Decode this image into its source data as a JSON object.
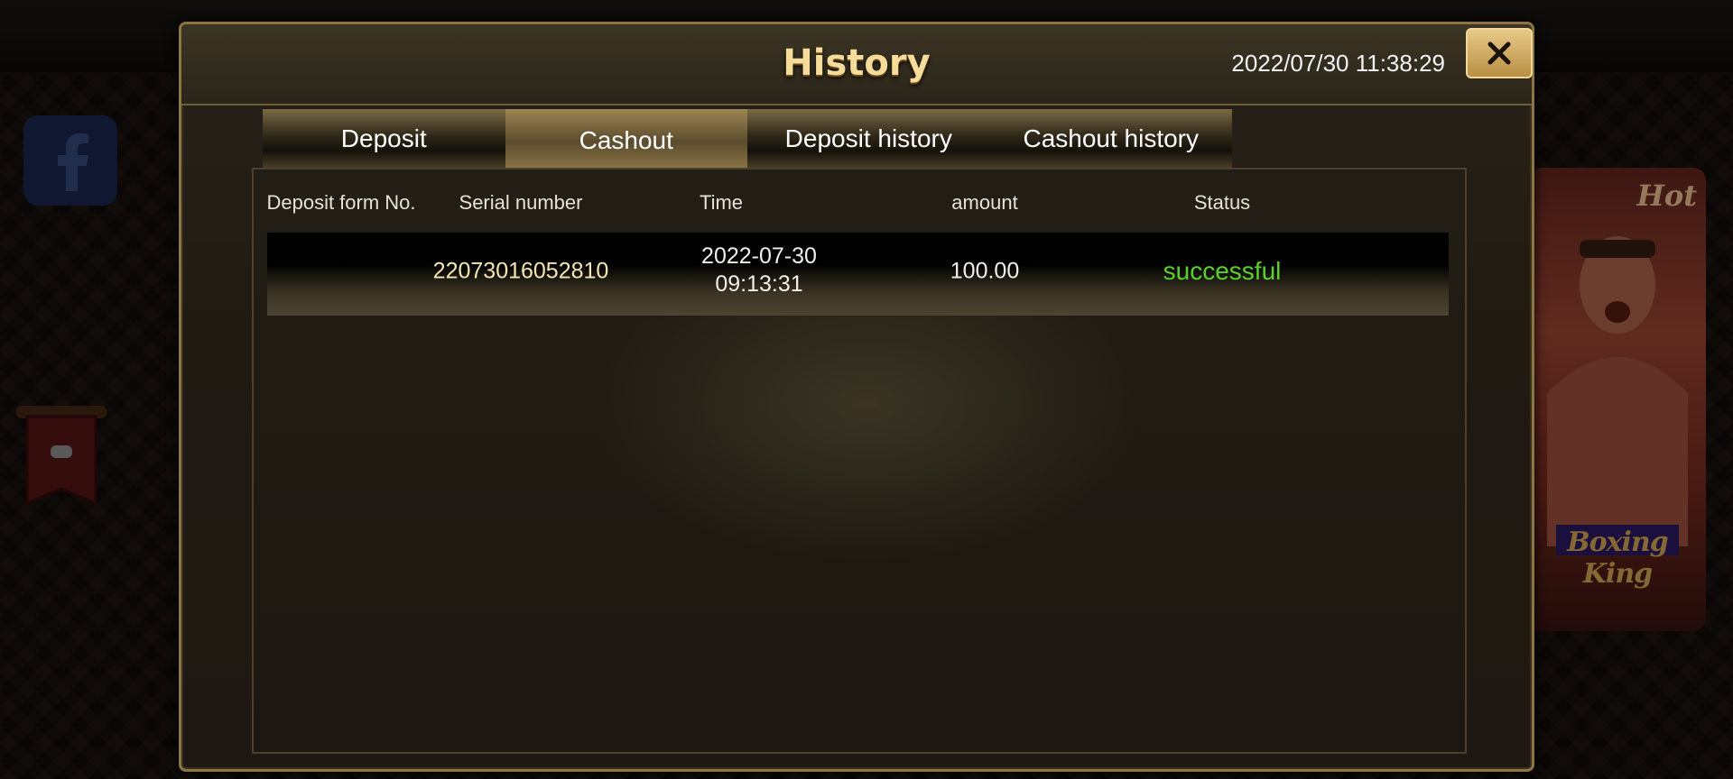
{
  "modal": {
    "title": "History",
    "datetime": "2022/07/30 11:38:29",
    "close_icon": "close-icon"
  },
  "tabs": [
    {
      "label": "Deposit",
      "active": false
    },
    {
      "label": "Cashout",
      "active": true
    },
    {
      "label": "Deposit history",
      "active": false
    },
    {
      "label": "Cashout history",
      "active": false
    }
  ],
  "table": {
    "columns": [
      "Deposit form No.",
      "Serial number",
      "Time",
      "amount",
      "Status"
    ],
    "rows": [
      {
        "deposit_form_no": "",
        "serial_number": "22073016052810",
        "time_date": "2022-07-30",
        "time_clock": "09:13:31",
        "amount": "100.00",
        "status": "successful"
      }
    ]
  },
  "colors": {
    "title": "#f6dc9a",
    "status_success": "#59d12a",
    "serial": "#f3e6b0",
    "modal_border": "#8a7543",
    "close_button": "#d8b56c"
  },
  "background": {
    "facebook_icon": "facebook-icon",
    "slot_game_title": "Boxing King",
    "slot_game_tag": "Hot"
  }
}
